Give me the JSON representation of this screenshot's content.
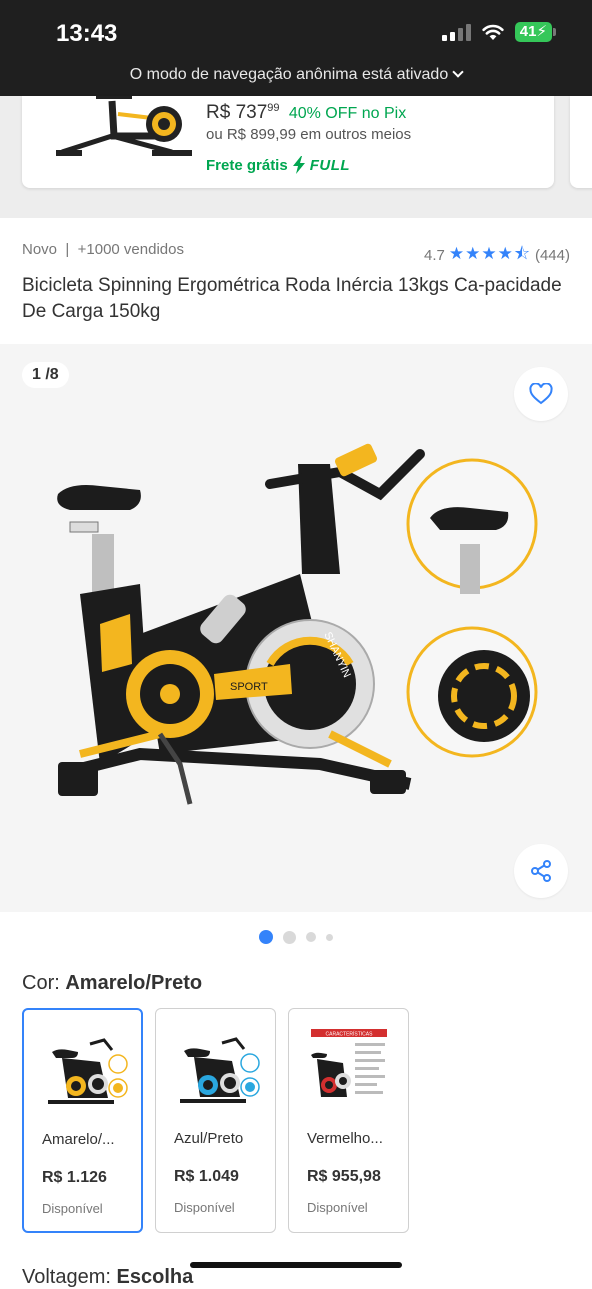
{
  "status_bar": {
    "time": "13:43",
    "battery": "41"
  },
  "incognito_banner": "O modo de navegação anônima está ativado",
  "top_card": {
    "price_currency": "R$",
    "price_int": "737",
    "price_cents": "99",
    "discount": "40% OFF no Pix",
    "other_price": "ou R$ 899,99 em outros meios",
    "shipping": "Frete grátis",
    "shipping_badge": "FULL"
  },
  "product": {
    "condition": "Novo",
    "separator": "|",
    "sold": "+1000 vendidos",
    "rating": "4.7",
    "stars": 4.5,
    "reviews": "(444)",
    "title": "Bicicleta Spinning Ergométrica Roda Inércia 13kgs Ca-pacidade De Carga 150kg"
  },
  "gallery": {
    "counter": "1 /8",
    "current_index": 1,
    "total_images": 8,
    "bike_brand": "SHANYIN",
    "bike_label": "SPORT",
    "accent_color": "#f3b61f"
  },
  "variations": {
    "label": "Cor:",
    "selected": "Amarelo/Preto",
    "options": [
      {
        "name": "Amarelo/...",
        "price": "R$ 1.126",
        "stock": "Disponível",
        "accent": "#f3b61f"
      },
      {
        "name": "Azul/Preto",
        "price": "R$ 1.049",
        "stock": "Disponível",
        "accent": "#2aa7df"
      },
      {
        "name": "Vermelho...",
        "price": "R$ 955,98",
        "stock": "Disponível",
        "accent": "#d32f2f",
        "badge": "CARACTERÍSTICAS"
      }
    ]
  },
  "voltage": {
    "label": "Voltagem:",
    "value": "Escolha"
  },
  "colors": {
    "brand_blue": "#3483fa",
    "green": "#00a650",
    "star_blue": "#3483fa"
  }
}
